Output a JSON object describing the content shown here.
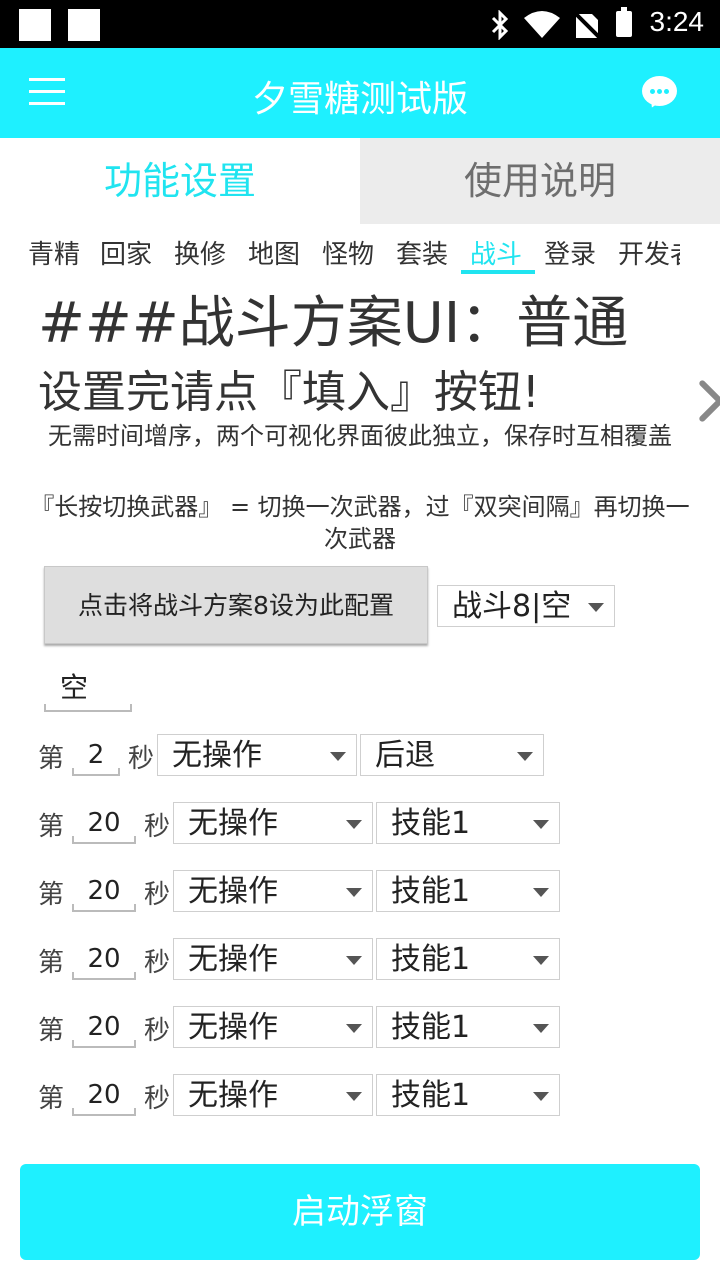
{
  "status_bar": {
    "time": "3:24"
  },
  "app_bar": {
    "title": "夕雪糖测试版"
  },
  "main_tabs": [
    {
      "label": "功能设置",
      "active": true
    },
    {
      "label": "使用说明",
      "active": false
    }
  ],
  "sub_tabs": [
    "青精",
    "回家",
    "换修",
    "地图",
    "怪物",
    "套装",
    "战斗",
    "登录",
    "开发者"
  ],
  "active_sub_tab": "战斗",
  "content": {
    "heading": "###战斗方案UI：普通",
    "subheading": "设置完请点『填入』按钮!",
    "note_1": "无需时间增序，两个可视化界面彼此独立，保存时互相覆盖",
    "note_2": "『长按切换武器』 = 切换一次武器，过『双突间隔』再切换一次武器"
  },
  "config": {
    "button_label": "点击将战斗方案8设为此配置",
    "plan_select": "战斗8|空",
    "name_value": "空"
  },
  "rows": [
    {
      "prefix": "第",
      "seconds": "2",
      "suffix": "秒",
      "action": "无操作",
      "move": "后退"
    },
    {
      "prefix": "第",
      "seconds": "20",
      "suffix": "秒",
      "action": "无操作",
      "move": "技能1"
    },
    {
      "prefix": "第",
      "seconds": "20",
      "suffix": "秒",
      "action": "无操作",
      "move": "技能1"
    },
    {
      "prefix": "第",
      "seconds": "20",
      "suffix": "秒",
      "action": "无操作",
      "move": "技能1"
    },
    {
      "prefix": "第",
      "seconds": "20",
      "suffix": "秒",
      "action": "无操作",
      "move": "技能1"
    },
    {
      "prefix": "第",
      "seconds": "20",
      "suffix": "秒",
      "action": "无操作",
      "move": "技能1"
    }
  ],
  "start_button": {
    "label": "启动浮窗"
  },
  "colors": {
    "accent": "#1ef0ff",
    "tab_inactive_bg": "#ececec"
  },
  "icons": [
    "menu-icon",
    "chat-icon",
    "bluetooth-icon",
    "wifi-icon",
    "signal-off-icon",
    "battery-icon",
    "close-icon"
  ]
}
